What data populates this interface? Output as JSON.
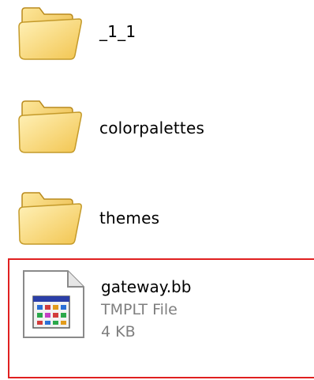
{
  "items": [
    {
      "name": "_1_1",
      "type": "folder",
      "icon": "folder-icon"
    },
    {
      "name": "colorpalettes",
      "type": "folder",
      "icon": "folder-icon"
    },
    {
      "name": "themes",
      "type": "folder",
      "icon": "folder-icon"
    }
  ],
  "selected_file": {
    "name": "gateway.bb",
    "file_type": "TMPLT File",
    "size": "4 KB",
    "icon": "template-file-icon"
  },
  "colors": {
    "highlight_border": "#e02020",
    "folder_body": "#f6d36a",
    "folder_shade": "#e2b33a",
    "secondary_text": "#7f7f7f"
  }
}
